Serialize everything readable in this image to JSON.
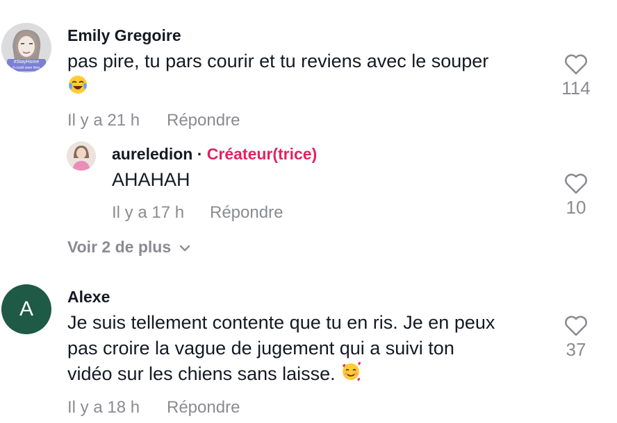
{
  "comments": [
    {
      "username": "Emily Gregoire",
      "avatar_badge": "#StayHome",
      "avatar_badge_sub": "it could save lives",
      "text": "pas pire, tu pars courir et tu reviens avec le souper",
      "emoji": "face-with-tears-of-joy",
      "time": "Il y a 21 h",
      "reply_label": "Répondre",
      "likes": "114",
      "replies": [
        {
          "username": "aureledion",
          "separator": "·",
          "role": "Créateur(trice)",
          "text": "AHAHAH",
          "time": "Il y a 17 h",
          "reply_label": "Répondre",
          "likes": "10"
        }
      ],
      "more_replies_label": "Voir 2 de plus"
    },
    {
      "username": "Alexe",
      "avatar_letter": "A",
      "avatar_color": "#1e5a45",
      "text_line1": "Je suis tellement contente que tu en ris. Je en peux",
      "text_line2": "pas croire la vague de jugement qui a suivi ton",
      "text_line3": "vidéo sur les chiens sans laisse.",
      "emoji": "smiling-face-with-hearts",
      "time": "Il y a 18 h",
      "reply_label": "Répondre",
      "likes": "37"
    }
  ],
  "colors": {
    "creator": "#e0245e",
    "meta": "#8a8b91",
    "text": "#161823"
  }
}
